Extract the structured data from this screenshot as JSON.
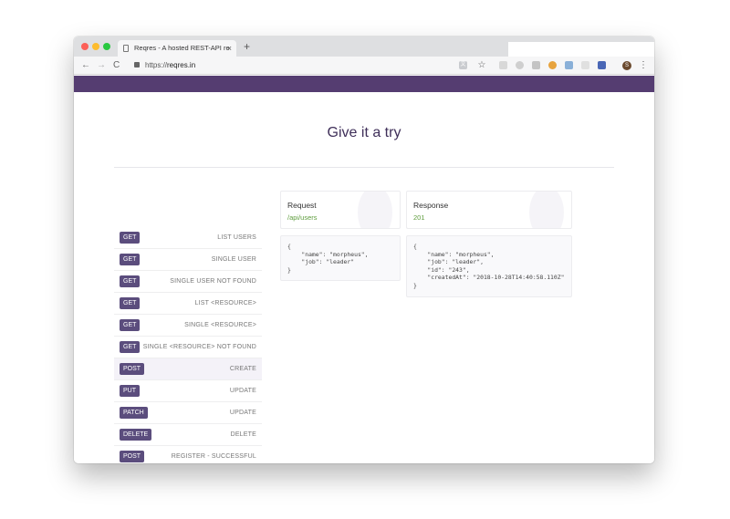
{
  "browser": {
    "tab_title": "Reqres - A hosted REST-API re",
    "tab_close": "×",
    "new_tab": "+",
    "url_scheme": "https://",
    "url_host": "reqres.in",
    "profile_initial": "S"
  },
  "page": {
    "heading": "Give it a try",
    "endpoints": [
      {
        "method": "GET",
        "label": "LIST USERS"
      },
      {
        "method": "GET",
        "label": "SINGLE USER"
      },
      {
        "method": "GET",
        "label": "SINGLE USER NOT FOUND"
      },
      {
        "method": "GET",
        "label": "LIST <RESOURCE>"
      },
      {
        "method": "GET",
        "label": "SINGLE <RESOURCE>"
      },
      {
        "method": "GET",
        "label": "SINGLE <RESOURCE> NOT FOUND"
      },
      {
        "method": "POST",
        "label": "CREATE"
      },
      {
        "method": "PUT",
        "label": "UPDATE"
      },
      {
        "method": "PATCH",
        "label": "UPDATE"
      },
      {
        "method": "DELETE",
        "label": "DELETE"
      },
      {
        "method": "POST",
        "label": "REGISTER - SUCCESSFUL"
      }
    ],
    "active_endpoint": "CREATE",
    "request": {
      "title": "Request",
      "path": "/api/users",
      "body_lines": [
        "{",
        "    \"name\": \"morpheus\",",
        "    \"job\": \"leader\"",
        "}"
      ]
    },
    "response": {
      "title": "Response",
      "status": "201",
      "body_lines": [
        "{",
        "    \"name\": \"morpheus\",",
        "    \"job\": \"leader\",",
        "    \"id\": \"243\",",
        "    \"createdAt\": \"2018-10-28T14:40:58.110Z\"",
        "}"
      ]
    }
  },
  "colors": {
    "brand_purple": "#553d71",
    "method_badge": "#5b4d7d",
    "status_green": "#5f9d3e"
  }
}
